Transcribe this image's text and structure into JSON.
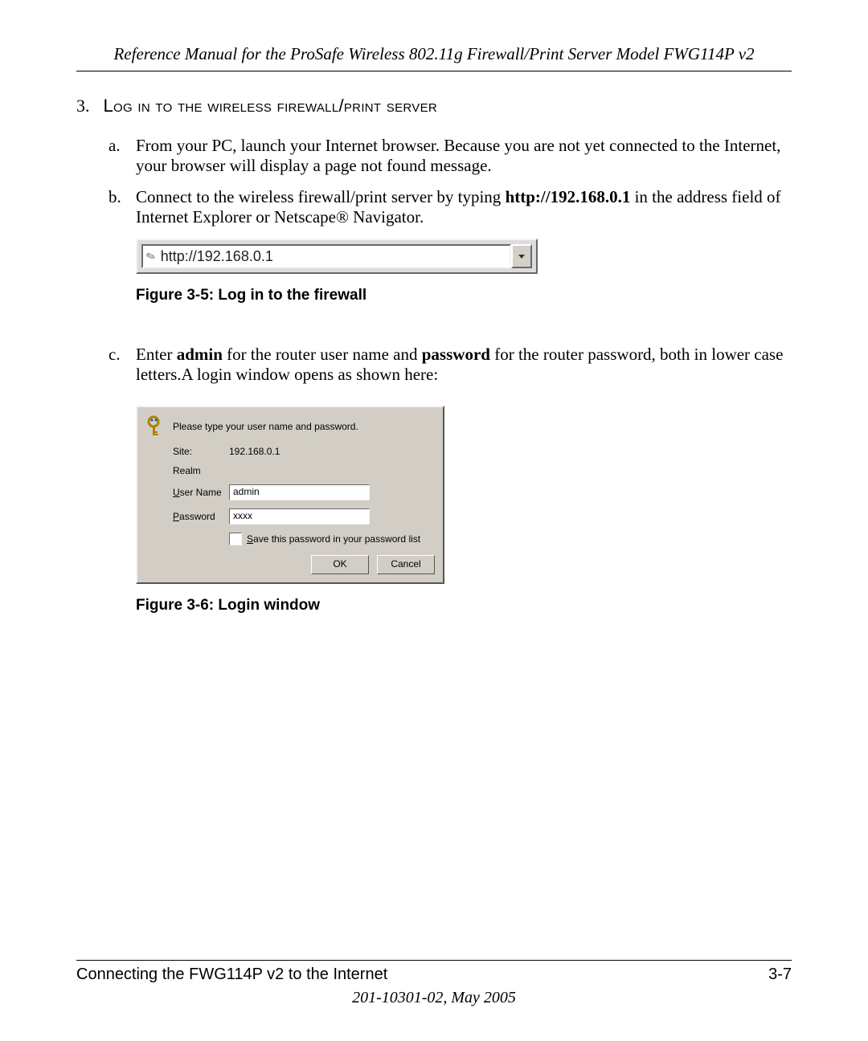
{
  "header": {
    "title": "Reference Manual for the ProSafe Wireless 802.11g  Firewall/Print Server Model FWG114P v2"
  },
  "step": {
    "number": "3.",
    "title_smallcaps": "Log in to the wireless firewall/print server"
  },
  "items": {
    "a": {
      "letter": "a.",
      "text": "From your PC, launch your Internet browser. Because you are not yet connected to the Internet, your browser will display a page not found message."
    },
    "b": {
      "letter": "b.",
      "pre": "Connect to the wireless firewall/print server by typing ",
      "bold": "http://192.168.0.1",
      "post": " in the address field of Internet Explorer or Netscape® Navigator."
    },
    "c": {
      "letter": "c.",
      "pre": "Enter ",
      "bold1": "admin",
      "mid": "  for the router user name and ",
      "bold2": "password",
      "post": " for the router password, both in lower case letters.A login window opens as shown here:"
    }
  },
  "address_bar": {
    "url": "http://192.168.0.1"
  },
  "figure_captions": {
    "f1": "Figure 3-5: Log in to the firewall",
    "f2": "Figure 3-6: Login window"
  },
  "login_dialog": {
    "prompt": "Please type your user name and password.",
    "site_label": "Site:",
    "site_value": "192.168.0.1",
    "realm_label": "Realm",
    "realm_value": "",
    "user_label_prefix": "U",
    "user_label_rest": "ser Name",
    "user_value": "admin",
    "pass_label_prefix": "P",
    "pass_label_rest": "assword",
    "pass_value": "xxxx",
    "save_prefix": "S",
    "save_rest": "ave this password in your password list",
    "ok": "OK",
    "cancel": "Cancel"
  },
  "footer": {
    "left": "Connecting the FWG114P v2 to the Internet",
    "right": "3-7",
    "docnum": "201-10301-02, May 2005"
  }
}
